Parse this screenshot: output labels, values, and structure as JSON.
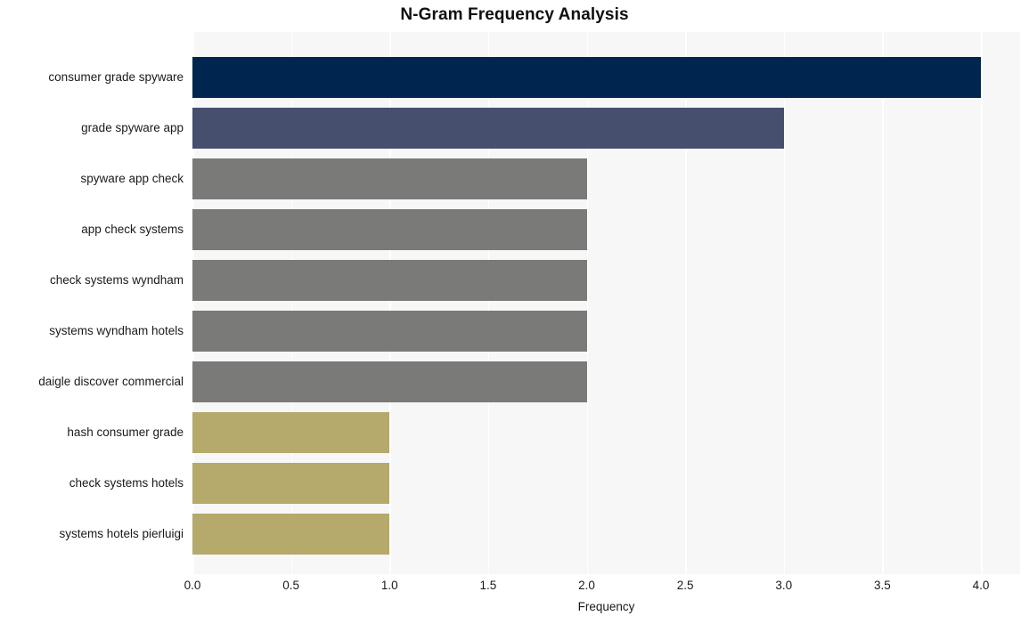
{
  "chart_data": {
    "type": "bar",
    "orientation": "horizontal",
    "title": "N-Gram Frequency Analysis",
    "xlabel": "Frequency",
    "ylabel": "",
    "categories": [
      "consumer grade spyware",
      "grade spyware app",
      "spyware app check",
      "app check systems",
      "check systems wyndham",
      "systems wyndham hotels",
      "daigle discover commercial",
      "hash consumer grade",
      "check systems hotels",
      "systems hotels pierluigi"
    ],
    "values": [
      4,
      3,
      2,
      2,
      2,
      2,
      2,
      1,
      1,
      1
    ],
    "bar_colors": [
      "#00254f",
      "#474f6e",
      "#7a7a78",
      "#7a7a78",
      "#7a7a78",
      "#7a7a78",
      "#7a7a78",
      "#b5a96c",
      "#b5a96c",
      "#b5a96c"
    ],
    "xlim": [
      0,
      4
    ],
    "xticks": [
      0,
      0.5,
      1,
      1.5,
      2,
      2.5,
      3,
      3.5,
      4
    ],
    "xtick_labels": [
      "0.0",
      "0.5",
      "1.0",
      "1.5",
      "2.0",
      "2.5",
      "3.0",
      "3.5",
      "4.0"
    ],
    "grid": true,
    "grid_axis": "x",
    "grid_color": "#ffffff",
    "plot_background": "#f7f7f7",
    "figure_background": "#ffffff",
    "legend": null,
    "legend_position": "none"
  }
}
